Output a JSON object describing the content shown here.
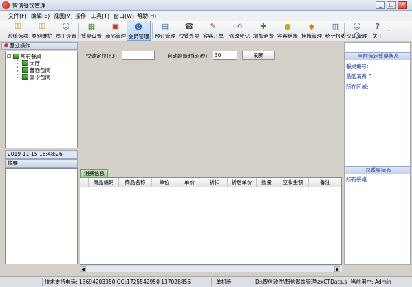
{
  "window": {
    "title": "智信餐饮管理",
    "minimize": "_",
    "restore": "□",
    "close": "×"
  },
  "menu": [
    "文件(F)",
    "编辑(E)",
    "视图(V)",
    "操作",
    "工具(T)",
    "窗口(W)",
    "帮助(H)"
  ],
  "toolbar": [
    {
      "label": "系统选项",
      "icon": "key-icon"
    },
    {
      "label": "类别维护",
      "icon": "key-icon"
    },
    {
      "label": "员工设置",
      "icon": "person-icon"
    },
    {
      "label": "餐桌设置",
      "icon": "table-icon"
    },
    {
      "label": "商品管理",
      "icon": "goods-icon"
    },
    {
      "label": "会员管理",
      "icon": "member-icon"
    },
    {
      "label": "预订管理",
      "icon": "book-icon"
    },
    {
      "label": "快餐外卖",
      "icon": "phone-icon"
    },
    {
      "label": "宾客开单",
      "icon": "order-icon"
    },
    {
      "label": "修改登记",
      "icon": "edit-icon"
    },
    {
      "label": "增加消费",
      "icon": "add-icon"
    },
    {
      "label": "宾客结账",
      "icon": "coin-icon"
    },
    {
      "label": "挂帐管理",
      "icon": "bag-icon"
    },
    {
      "label": "统计报表",
      "icon": "chart-icon"
    },
    {
      "label": "交班管理",
      "icon": "people-icon"
    },
    {
      "label": "关于",
      "icon": "help-icon"
    }
  ],
  "left_panel": {
    "header": "营业操作",
    "tree_root": "所有餐桌",
    "tree_children": [
      "大厅",
      "普通包间",
      "豪华包间"
    ],
    "datetime": "2019-11-15 16:48:26",
    "notes_header": "摘要"
  },
  "center": {
    "quick_locate_label": "快速定位(F3)",
    "quick_locate_value": "",
    "auto_refresh_label": "自动刷新时间(秒)",
    "auto_refresh_value": "30",
    "refresh_button": "刷新",
    "tab_label": "消费信息",
    "columns": [
      "商品编码",
      "商品名称",
      "单位",
      "单价",
      "折扣",
      "折后单价",
      "数量",
      "应收金额",
      "备注"
    ]
  },
  "right_panel": {
    "current_header": "当前选定餐桌状态",
    "table_no_label": "餐桌编号:",
    "min_consume_label": "最低消费:0",
    "area_label": "所在区域:",
    "total_header": "总餐桌状态",
    "all_tables_label": "所有餐桌"
  },
  "statusbar": {
    "support": "技术支持电话: 13694203350  QQ:1725542950  137028856",
    "mode": "单机版",
    "path": "D:\\智信软件\\智信餐饮管理\\zxCTData.sys",
    "user": "当前用户: Admin"
  }
}
